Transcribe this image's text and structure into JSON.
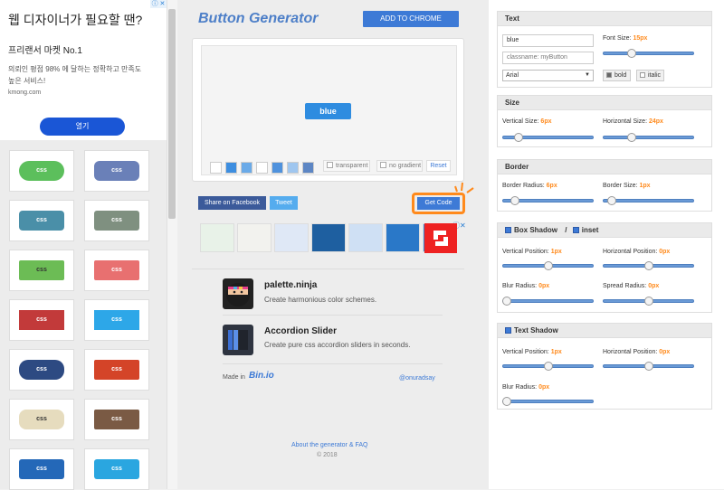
{
  "ad": {
    "headline": "웹 디자이너가 필요할 땐?",
    "subhead": "프리랜서 마켓 No.1",
    "body": "의뢰인 평점 98% 에 달하는 정확하고 만족도 높은 서비스!",
    "domain": "kmong.com",
    "cta": "열기",
    "badge": "ⓘ ✕"
  },
  "gallery": {
    "items": [
      {
        "label": "css",
        "bg": "#5cbf5c",
        "color": "#fff",
        "radius": "11px"
      },
      {
        "label": "css",
        "bg": "#6a80b8",
        "color": "#fff",
        "radius": "6px"
      },
      {
        "label": "css",
        "bg": "#4a8fa8",
        "color": "#fff",
        "radius": "4px"
      },
      {
        "label": "css",
        "bg": "#7f9080",
        "color": "#fff",
        "radius": "3px"
      },
      {
        "label": "css",
        "bg": "#6cbc55",
        "color": "#333",
        "radius": "2px"
      },
      {
        "label": "css",
        "bg": "#e87070",
        "color": "#fff",
        "radius": "2px"
      },
      {
        "label": "css",
        "bg": "#c23a3a",
        "color": "#fff",
        "radius": "0px"
      },
      {
        "label": "css",
        "bg": "#2da7e8",
        "color": "#fff",
        "radius": "0px"
      },
      {
        "label": "css",
        "bg": "#2d4a82",
        "color": "#fff",
        "radius": "10px"
      },
      {
        "label": "css",
        "bg": "#d44428",
        "color": "#fff",
        "radius": "2px"
      },
      {
        "label": "css",
        "bg": "#e6dcbe",
        "color": "#333",
        "radius": "8px"
      },
      {
        "label": "css",
        "bg": "#7a5a44",
        "color": "#fff",
        "radius": "2px"
      },
      {
        "label": "css",
        "bg": "#2468b8",
        "color": "#fff",
        "radius": "3px"
      },
      {
        "label": "css",
        "bg": "#2aa6e0",
        "color": "#fff",
        "radius": "3px"
      }
    ]
  },
  "header": {
    "brand": "Button Generator",
    "add_to_chrome": "ADD TO CHROME"
  },
  "preview": {
    "button_label": "blue",
    "swatches": [
      "#ffffff",
      "#3d8ee0",
      "#6aaae8",
      "#ffffff",
      "#4f92dd",
      "#9fc6ef",
      "#5d86c4"
    ],
    "transparent": "transparent",
    "no_gradient": "no gradient",
    "reset": "Reset"
  },
  "share": {
    "facebook": "Share on Facebook",
    "tweet": "Tweet",
    "get_code": "Get Code"
  },
  "adstrip": {
    "thumbs": [
      "#e8f2e8",
      "#f2f2ee",
      "#dfe8f6",
      "#1e5fa0",
      "#cfe0f4",
      "#2a78c8",
      "#3b82d0"
    ],
    "x": "ⓘ✕"
  },
  "promos": [
    {
      "title": "palette.ninja",
      "desc": "Create harmonious color schemes.",
      "icon_bg": "#222"
    },
    {
      "title": "Accordion Slider",
      "desc": "Create pure css accordion sliders in seconds.",
      "icon_bg": "#2e3440"
    }
  ],
  "footer": {
    "made_in": "Made in",
    "made_brand": "Bin.io",
    "twitter": "@onuradsay",
    "about": "About the generator & FAQ",
    "copyright": "© 2018"
  },
  "settings": {
    "text": {
      "header": "Text",
      "text_value": "blue",
      "classname_placeholder": "classname: myButton",
      "font": "Arial",
      "font_size_label": "Font Size:",
      "font_size_value": "15px",
      "font_size_level": 0.3,
      "bold": "bold",
      "italic": "italic"
    },
    "size": {
      "header": "Size",
      "vertical_label": "Vertical Size:",
      "vertical_value": "6px",
      "vertical_level": 0.14,
      "horizontal_label": "Horizontal Size:",
      "horizontal_value": "24px",
      "horizontal_level": 0.3
    },
    "border": {
      "header": "Border",
      "radius_label": "Border Radius:",
      "radius_value": "6px",
      "radius_level": 0.1,
      "size_label": "Border Size:",
      "size_value": "1px",
      "size_level": 0.05
    },
    "box_shadow": {
      "header": "Box Shadow",
      "separator": "/",
      "inset": "inset",
      "vpos_label": "Vertical Position:",
      "vpos_value": "1px",
      "vpos_level": 0.5,
      "hpos_label": "Horizontal Position:",
      "hpos_value": "0px",
      "hpos_level": 0.5,
      "blur_label": "Blur Radius:",
      "blur_value": "0px",
      "blur_level": 0.0,
      "spread_label": "Spread Radius:",
      "spread_value": "0px",
      "spread_level": 0.5
    },
    "text_shadow": {
      "header": "Text Shadow",
      "vpos_label": "Vertical Position:",
      "vpos_value": "1px",
      "vpos_level": 0.5,
      "hpos_label": "Horizontal Position:",
      "hpos_value": "0px",
      "hpos_level": 0.5,
      "blur_label": "Blur Radius:",
      "blur_value": "0px",
      "blur_level": 0.0
    }
  }
}
